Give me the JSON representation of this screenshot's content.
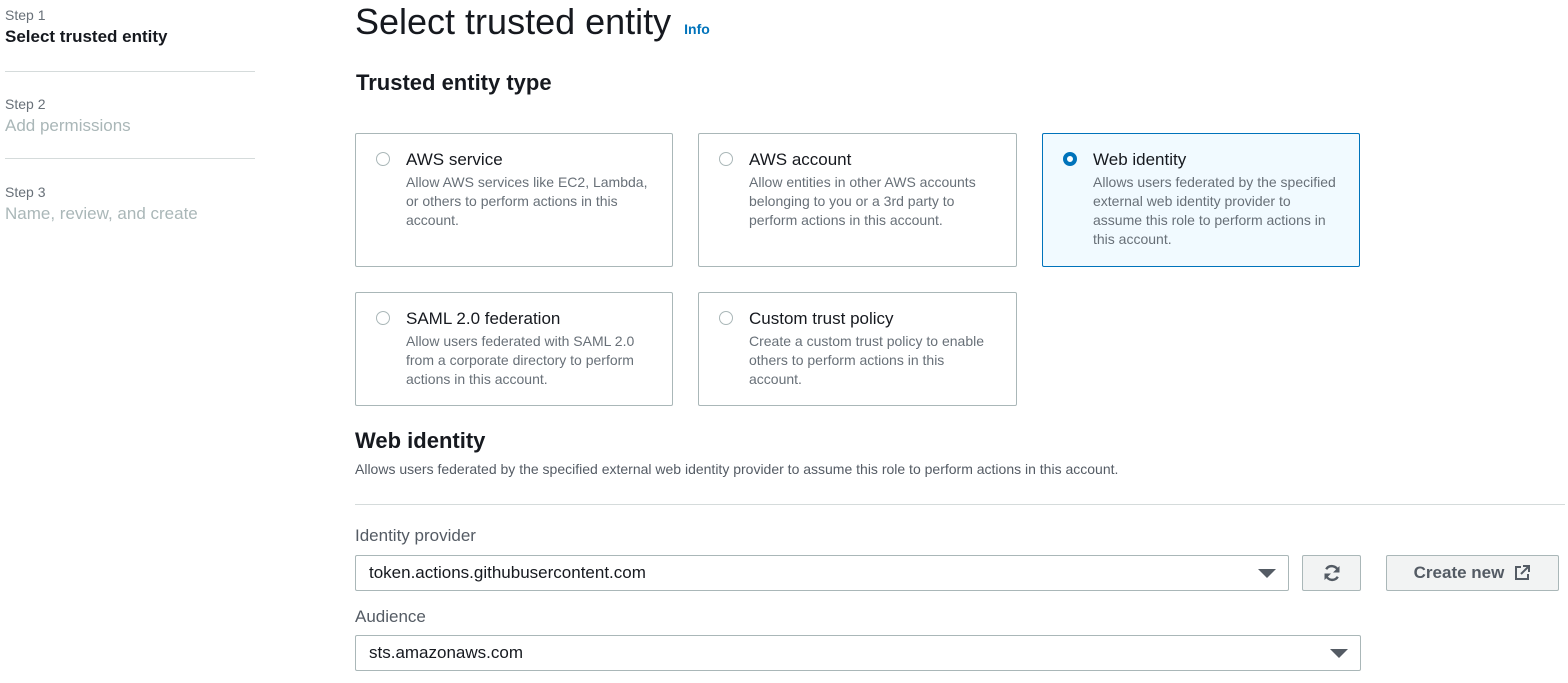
{
  "steps": [
    {
      "label": "Step 1",
      "title": "Select trusted entity",
      "state": "active"
    },
    {
      "label": "Step 2",
      "title": "Add permissions",
      "state": "inactive"
    },
    {
      "label": "Step 3",
      "title": "Name, review, and create",
      "state": "inactive"
    }
  ],
  "page": {
    "title": "Select trusted entity",
    "info_link": "Info"
  },
  "trusted_entity_type": {
    "heading": "Trusted entity type",
    "options": [
      {
        "title": "AWS service",
        "desc": "Allow AWS services like EC2, Lambda, or others to perform actions in this account.",
        "selected": false
      },
      {
        "title": "AWS account",
        "desc": "Allow entities in other AWS accounts belonging to you or a 3rd party to perform actions in this account.",
        "selected": false
      },
      {
        "title": "Web identity",
        "desc": "Allows users federated by the specified external web identity provider to assume this role to perform actions in this account.",
        "selected": true
      },
      {
        "title": "SAML 2.0 federation",
        "desc": "Allow users federated with SAML 2.0 from a corporate directory to perform actions in this account.",
        "selected": false
      },
      {
        "title": "Custom trust policy",
        "desc": "Create a custom trust policy to enable others to perform actions in this account.",
        "selected": false
      }
    ]
  },
  "web_identity": {
    "heading": "Web identity",
    "description": "Allows users federated by the specified external web identity provider to assume this role to perform actions in this account.",
    "identity_provider": {
      "label": "Identity provider",
      "value": "token.actions.githubusercontent.com",
      "refresh_icon": "refresh-icon",
      "create_new_label": "Create new",
      "external_link_icon": "external-link-icon"
    },
    "audience": {
      "label": "Audience",
      "value": "sts.amazonaws.com"
    }
  },
  "colors": {
    "accent": "#0073bb",
    "selected_bg": "#f1faff",
    "border": "#aab7b8",
    "muted_text": "#687078"
  }
}
